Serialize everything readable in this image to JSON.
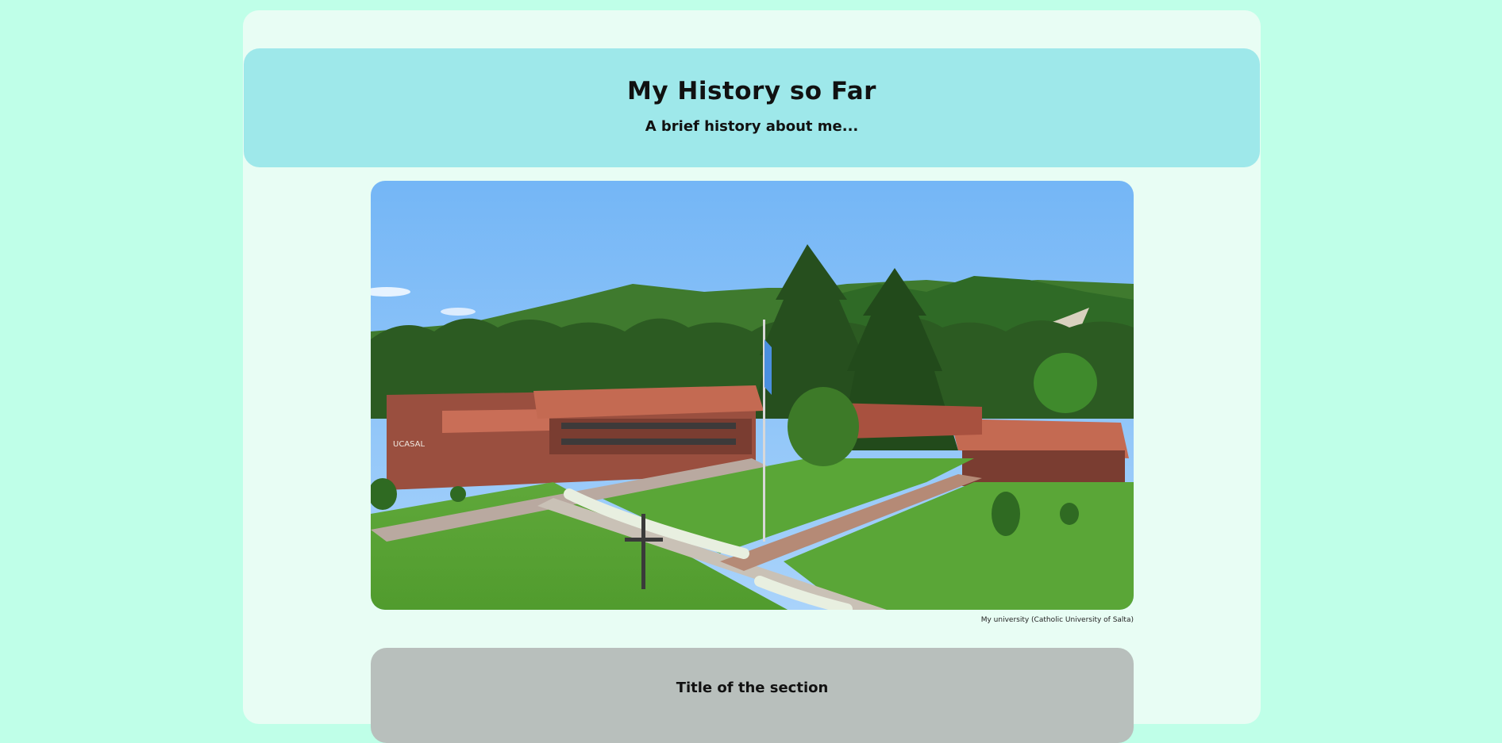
{
  "header": {
    "title": "My History so Far",
    "subtitle": "A brief history about me..."
  },
  "photo": {
    "caption": "My university (Catholic University of Salta)",
    "sign_text": "UCASAL"
  },
  "section": {
    "title": "Title of the section"
  }
}
